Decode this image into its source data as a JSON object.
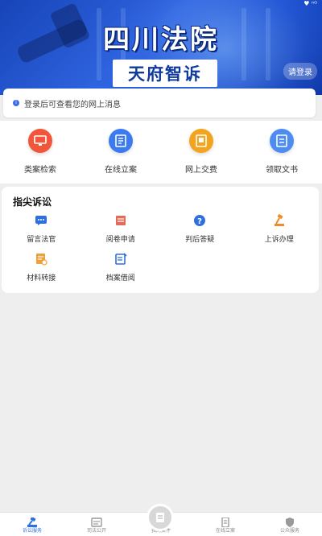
{
  "banner": {
    "title": "四川法院",
    "subtitle": "天府智诉",
    "login_label": "请登录",
    "status_text": "♥ ⁿᴳ"
  },
  "notice": {
    "text": "登录后可查看您的网上消息"
  },
  "quick_actions": [
    {
      "label": "类案检索",
      "icon": "monitor-icon",
      "color": "#f1553b"
    },
    {
      "label": "在线立案",
      "icon": "document-edit-icon",
      "color": "#3b7af0"
    },
    {
      "label": "网上交费",
      "icon": "payment-icon",
      "color": "#f4a41c"
    },
    {
      "label": "领取文书",
      "icon": "document-icon",
      "color": "#4d8cf2"
    }
  ],
  "section": {
    "title": "指尖诉讼",
    "items": [
      {
        "label": "留言法官",
        "icon": "message-icon",
        "color": "#2f6fe0"
      },
      {
        "label": "阅卷申请",
        "icon": "file-review-icon",
        "color": "#e26b5c"
      },
      {
        "label": "判后答疑",
        "icon": "question-icon",
        "color": "#2f6fe0"
      },
      {
        "label": "上诉办理",
        "icon": "gavel-icon",
        "color": "#f08a2a"
      },
      {
        "label": "材料转接",
        "icon": "material-transfer-icon",
        "color": "#f0a13a"
      },
      {
        "label": "档案借阅",
        "icon": "archive-icon",
        "color": "#2f6fe0"
      }
    ]
  },
  "bottom_nav": [
    {
      "label": "诉讼服务",
      "icon": "gavel-icon",
      "active": true
    },
    {
      "label": "司法公开",
      "icon": "news-icon",
      "active": false
    },
    {
      "label": "我的案件",
      "icon": "case-folder-icon",
      "active": false
    },
    {
      "label": "在线立案",
      "icon": "file-icon",
      "active": false
    },
    {
      "label": "公众服务",
      "icon": "shield-icon",
      "active": false
    }
  ]
}
